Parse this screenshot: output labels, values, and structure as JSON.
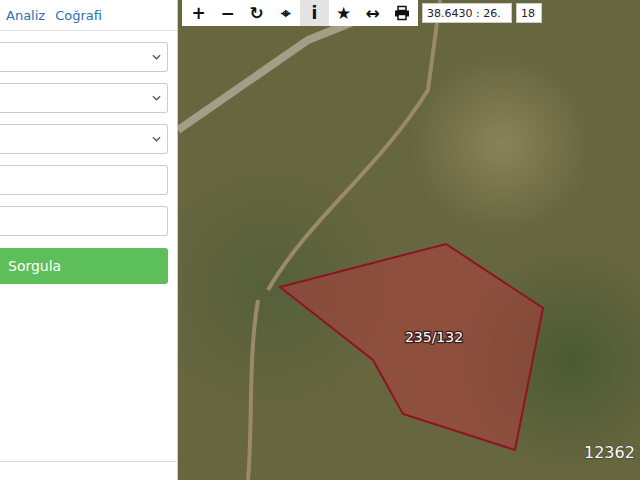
{
  "tabs": [
    {
      "label": "Analiz",
      "selected": false
    },
    {
      "label": "Coğrafi",
      "selected": false
    }
  ],
  "form": {
    "fields": [
      {
        "kind": "select"
      },
      {
        "kind": "select"
      },
      {
        "kind": "select"
      },
      {
        "kind": "input"
      },
      {
        "kind": "input"
      }
    ],
    "button": "Sorgula"
  },
  "toolbar": {
    "tools": [
      {
        "kind": "glyph",
        "label": "+",
        "selected": false
      },
      {
        "kind": "glyph",
        "label": "−",
        "selected": false
      },
      {
        "kind": "glyph",
        "label": "↻",
        "selected": false
      },
      {
        "kind": "glyph",
        "label": "⌖",
        "selected": false
      },
      {
        "kind": "glyph",
        "label": "i",
        "selected": true
      },
      {
        "kind": "glyph",
        "label": "★",
        "selected": false
      },
      {
        "kind": "glyph",
        "label": "↔",
        "selected": false
      },
      {
        "kind": "print",
        "label": "",
        "selected": false
      }
    ],
    "coordinates": "38.6430 : 26.",
    "zoom": "18"
  },
  "map": {
    "parcels": [
      {
        "label": "235/132"
      }
    ],
    "labels": [
      "12362"
    ]
  }
}
